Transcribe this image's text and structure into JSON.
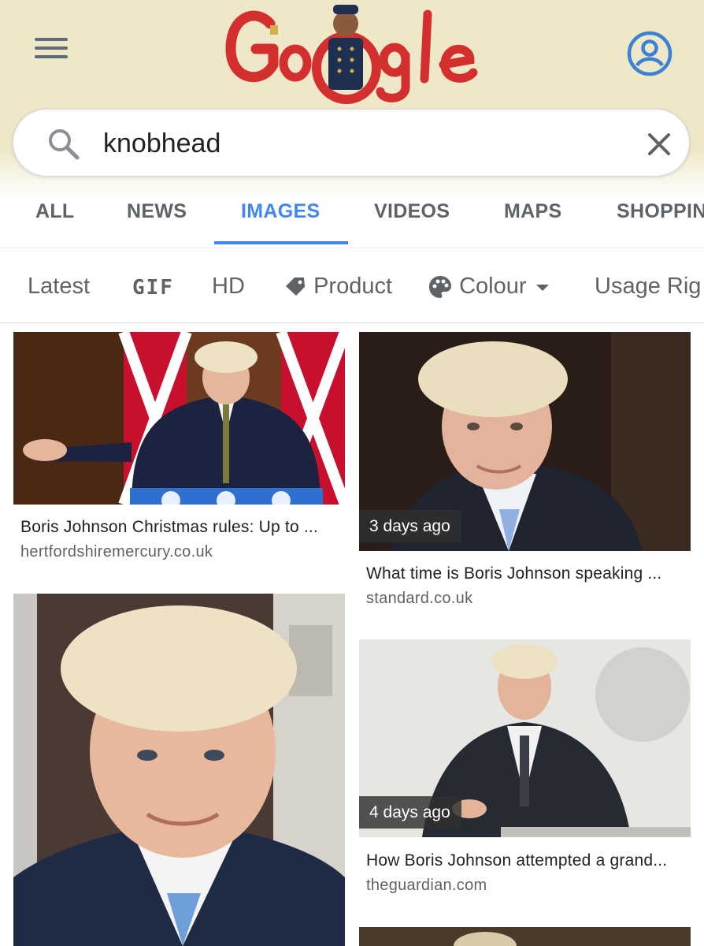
{
  "header": {
    "menu_icon": "hamburger-menu-icon",
    "account_icon": "account-circle-icon",
    "logo_text": "Google",
    "doodle_description": "Google logo doodle"
  },
  "search": {
    "query": "knobhead",
    "placeholder": "",
    "search_icon": "search-icon",
    "clear_icon": "close-icon"
  },
  "tabs": [
    {
      "label": "ALL",
      "active": false
    },
    {
      "label": "NEWS",
      "active": false
    },
    {
      "label": "IMAGES",
      "active": true
    },
    {
      "label": "VIDEOS",
      "active": false
    },
    {
      "label": "MAPS",
      "active": false
    },
    {
      "label": "SHOPPIN",
      "active": false
    }
  ],
  "filters": {
    "latest": "Latest",
    "gif": "GIF",
    "hd": "HD",
    "product": "Product",
    "colour": "Colour",
    "usage": "Usage Rig"
  },
  "results": [
    {
      "title": "Boris Johnson Christmas rules: Up to ...",
      "source": "hertfordshiremercury.co.uk",
      "age": ""
    },
    {
      "title": "What time is Boris Johnson speaking ...",
      "source": "standard.co.uk",
      "age": "3 days ago"
    },
    {
      "title": "",
      "source": "",
      "age": ""
    },
    {
      "title": "How Boris Johnson attempted a grand...",
      "source": "theguardian.com",
      "age": "4 days ago"
    }
  ],
  "colors": {
    "accent": "#4285f4",
    "header_bg": "#efe8c8",
    "logo_red": "#d32f2f",
    "tab_inactive": "#5f6368"
  }
}
